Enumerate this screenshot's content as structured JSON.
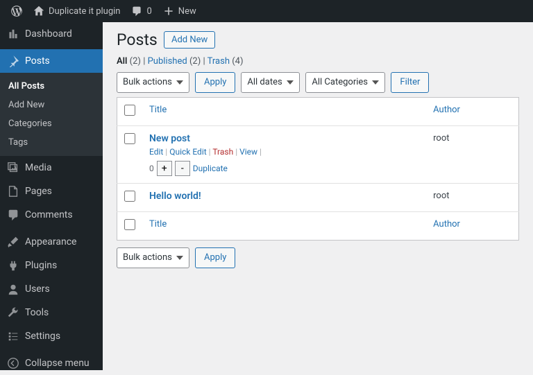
{
  "adminbar": {
    "site": "Duplicate it plugin",
    "comments": "0",
    "new": "New"
  },
  "menu": {
    "dashboard": "Dashboard",
    "posts": "Posts",
    "media": "Media",
    "pages": "Pages",
    "comments": "Comments",
    "appearance": "Appearance",
    "plugins": "Plugins",
    "users": "Users",
    "tools": "Tools",
    "settings": "Settings",
    "collapse": "Collapse menu"
  },
  "submenu": {
    "all": "All Posts",
    "new": "Add New",
    "cat": "Categories",
    "tags": "Tags"
  },
  "heading": "Posts",
  "addnew": "Add New",
  "views": {
    "all": "All",
    "all_count": "(2)",
    "pub": "Published",
    "pub_count": "(2)",
    "trash": "Trash",
    "trash_count": "(4)"
  },
  "filters": {
    "bulk": "Bulk actions",
    "apply": "Apply",
    "dates": "All dates",
    "cats": "All Categories",
    "filter": "Filter"
  },
  "cols": {
    "title": "Title",
    "author": "Author"
  },
  "rows": [
    {
      "title": "New post",
      "author": "root",
      "actions": {
        "edit": "Edit",
        "quick": "Quick Edit",
        "trash": "Trash",
        "view": "View"
      },
      "dup": {
        "count": "0",
        "plus": "+",
        "minus": "-",
        "label": "Duplicate"
      }
    },
    {
      "title": "Hello world!",
      "author": "root"
    }
  ]
}
